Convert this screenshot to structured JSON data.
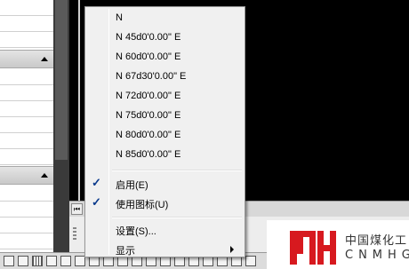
{
  "context_menu": {
    "angles": [
      {
        "label": "N"
      },
      {
        "label": "N 45d0'0.00\" E"
      },
      {
        "label": "N 60d0'0.00\" E"
      },
      {
        "label": "N 67d30'0.00\" E"
      },
      {
        "label": "N 72d0'0.00\" E"
      },
      {
        "label": "N 75d0'0.00\" E"
      },
      {
        "label": "N 80d0'0.00\" E"
      },
      {
        "label": "N 85d0'0.00\" E"
      }
    ],
    "enable": {
      "label": "启用(E)",
      "checked": true
    },
    "use_icon": {
      "label": "使用图标(U)",
      "checked": true
    },
    "settings": {
      "label": "设置(S)..."
    },
    "display": {
      "label": "显示"
    },
    "check_glyph": "✓"
  },
  "layout_tabs": {
    "nav_first": "⏮"
  },
  "logo": {
    "cn_text": "中国煤化工",
    "en_text": "CNMHG",
    "color": "#d7191f"
  },
  "colors": {
    "menu_bg": "#f0f0f0",
    "check": "#0b3a8c",
    "canvas": "#000000"
  }
}
